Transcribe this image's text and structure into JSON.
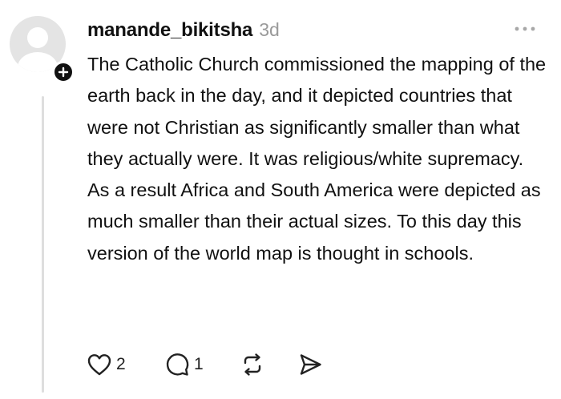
{
  "comment": {
    "author": "manande_bikitsha",
    "age": "3d",
    "text": "The Catholic Church commissioned the mapping of the earth back in the day, and it depicted countries that were not Christian as significantly smaller than what they actually were. It was religious/white supremacy. As a result Africa and South America were depicted as much smaller than their actual sizes. To this day this version of the world map is thought in schools.",
    "likes": "2",
    "replies": "1"
  },
  "icons": {
    "avatar": "default-avatar-icon",
    "badge": "plus-icon",
    "menu": "more-horizontal-icon",
    "like": "heart-icon",
    "reply": "comment-icon",
    "repost": "repost-icon",
    "share": "send-icon"
  },
  "colors": {
    "text": "#111111",
    "muted": "#9a9a9a",
    "avatar_bg": "#e4e4e4",
    "thread_line": "#dedede"
  }
}
